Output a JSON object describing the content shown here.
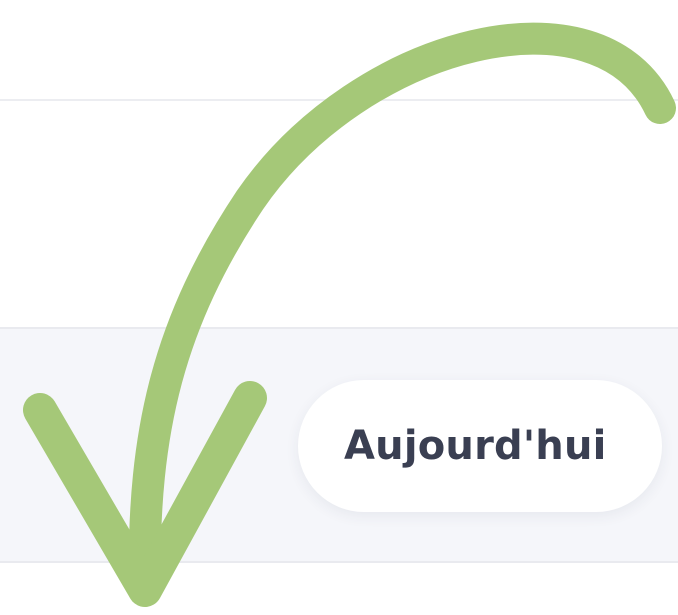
{
  "toolbar": {
    "today_button_label": "Aujourd'hui"
  },
  "annotation": {
    "icon": "curved-arrow-down-icon",
    "color": "#a5c878"
  }
}
